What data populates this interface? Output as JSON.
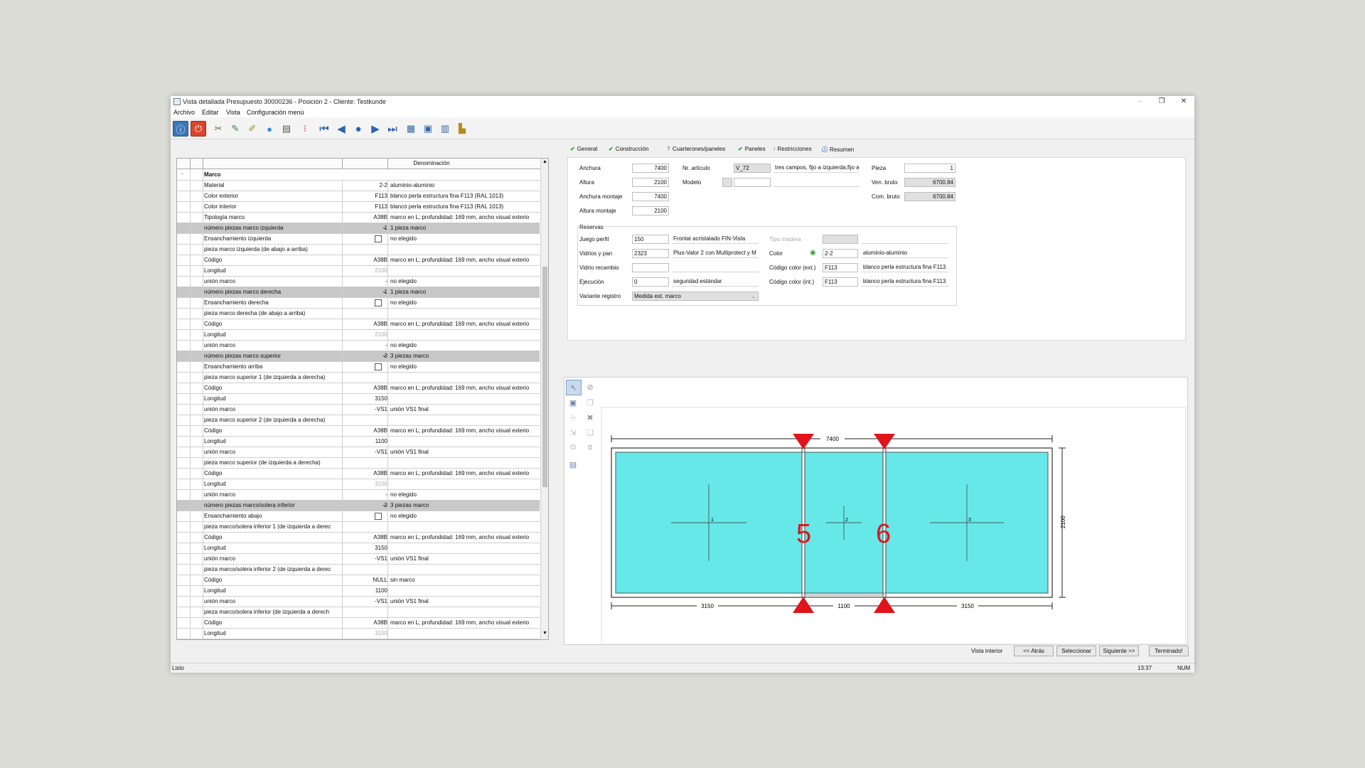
{
  "window": {
    "title": "Vista detallada Presupuesto 30000236 - Posición 2 - Cliente: Testkunde",
    "minimize_glyph": "–",
    "restore_glyph": "❐",
    "close_glyph": "✕"
  },
  "menu": [
    "Archivo",
    "Editar",
    "Vista",
    "Configuración menú"
  ],
  "toolbar": {
    "icons": [
      "info-icon",
      "power-icon",
      "tools-icon",
      "edit-icon",
      "pen-icon",
      "colors-icon",
      "document-icon",
      "traffic-light-icon",
      "first-icon",
      "prev-icon",
      "record-icon",
      "next-icon",
      "last-icon",
      "grid-view-icon",
      "select-view-icon",
      "table-view-icon",
      "tree-view-icon"
    ]
  },
  "grid": {
    "header": "Denominación",
    "collapse": "-",
    "section": "Marco",
    "rows": [
      {
        "k": "Material",
        "v": "2-2",
        "d": "aluminio-aluminio"
      },
      {
        "k": "Color exterior",
        "v": "F113",
        "d": "blanco perla estructura fina F113 (RAL 1013)"
      },
      {
        "k": "Color interior",
        "v": "F113",
        "d": "blanco perla estructura fina F113 (RAL 1013)"
      },
      {
        "k": "Tipología marco",
        "v": "A38B",
        "d": "marco en L; profundidad: 169 mm, ancho visual exterio"
      },
      {
        "k": "número piezas marco izquierda",
        "v": "1",
        "d": "1 pieza marco",
        "gray": true,
        "dd": true
      },
      {
        "k": "Ensanchamiento izquierda",
        "v": "",
        "d": "no elegido",
        "chk": true
      },
      {
        "k": "pieza marco izquierda (de abajo a arriba)",
        "v": "",
        "d": ""
      },
      {
        "k": "Código",
        "v": "A38B",
        "d": "marco en L; profundidad: 169 mm, ancho visual exterio"
      },
      {
        "k": "Longitud",
        "v": "2100",
        "d": "",
        "dim": true
      },
      {
        "k": "unión marco",
        "v": "-",
        "d": "no elegido"
      },
      {
        "k": "número piezas marco derecha",
        "v": "1",
        "d": "1 pieza marco",
        "gray": true,
        "dd": true
      },
      {
        "k": "Ensanchamiento derecha",
        "v": "",
        "d": "no elegido",
        "chk": true
      },
      {
        "k": "pieza marco derecha (de abajo a arriba)",
        "v": "",
        "d": ""
      },
      {
        "k": "Código",
        "v": "A38B",
        "d": "marco en L; profundidad: 169 mm, ancho visual exterio"
      },
      {
        "k": "Longitud",
        "v": "2100",
        "d": "",
        "dim": true
      },
      {
        "k": "unión marco",
        "v": "-",
        "d": "no elegido"
      },
      {
        "k": "número piezas marco superior",
        "v": "3",
        "d": "3 piezas marco",
        "gray": true,
        "dd": true
      },
      {
        "k": "Ensanchamiento arriba",
        "v": "",
        "d": "no elegido",
        "chk": true
      },
      {
        "k": "pieza marco superior 1 (de izquierda a derecha)",
        "v": "",
        "d": ""
      },
      {
        "k": "Código",
        "v": "A38B",
        "d": "marco en L; profundidad: 169 mm, ancho visual exterio"
      },
      {
        "k": "Longitud",
        "v": "3150",
        "d": ""
      },
      {
        "k": "unión marco",
        "v": "-VS1",
        "d": "unión VS1 final"
      },
      {
        "k": "pieza marco superior 2 (de izquierda a derecha)",
        "v": "",
        "d": ""
      },
      {
        "k": "Código",
        "v": "A38B",
        "d": "marco en L; profundidad: 169 mm, ancho visual exterio"
      },
      {
        "k": "Longitud",
        "v": "1100",
        "d": ""
      },
      {
        "k": "unión marco",
        "v": "-VS1",
        "d": "unión VS1 final"
      },
      {
        "k": "pieza marco superior (de izquierda a derecha)",
        "v": "",
        "d": ""
      },
      {
        "k": "Código",
        "v": "A38B",
        "d": "marco en L; profundidad: 169 mm, ancho visual exterio"
      },
      {
        "k": "Longitud",
        "v": "3150",
        "d": "",
        "dim": true
      },
      {
        "k": "unión marco",
        "v": "-",
        "d": "no elegido"
      },
      {
        "k": "número piezas marco/solera inferior",
        "v": "3",
        "d": "3 piezas marco",
        "gray": true,
        "dd": true
      },
      {
        "k": "Ensanchamiento abajo",
        "v": "",
        "d": "no elegido",
        "chk": true
      },
      {
        "k": "pieza marco/solera inferior 1 (de izquierda a derec",
        "v": "",
        "d": ""
      },
      {
        "k": "Código",
        "v": "A38B",
        "d": "marco en L; profundidad: 169 mm, ancho visual exterio"
      },
      {
        "k": "Longitud",
        "v": "3150",
        "d": ""
      },
      {
        "k": "unión marco",
        "v": "-VS1",
        "d": "unión VS1 final"
      },
      {
        "k": "pieza marco/solera inferior 2 (de izquierda a derec",
        "v": "",
        "d": ""
      },
      {
        "k": "Código",
        "v": "NULL",
        "d": "sin marco"
      },
      {
        "k": "Longitud",
        "v": "1100",
        "d": ""
      },
      {
        "k": "unión marco",
        "v": "-VS1",
        "d": "unión VS1 final"
      },
      {
        "k": "pieza marco/solera inferior (de izquierda a derech",
        "v": "",
        "d": ""
      },
      {
        "k": "Código",
        "v": "A38B",
        "d": "marco en L; profundidad: 169 mm, ancho visual exterio"
      },
      {
        "k": "Longitud",
        "v": "3150",
        "d": "",
        "dim": true
      }
    ]
  },
  "tabs": [
    {
      "label": "General",
      "icon": "check-icon"
    },
    {
      "label": "Construcción",
      "icon": "check-icon"
    },
    {
      "label": "Cuarterones/paneles",
      "icon": "question-icon"
    },
    {
      "label": "Paneles",
      "icon": "check-icon"
    },
    {
      "label": "Restricciones",
      "icon": "warning-icon"
    },
    {
      "label": "Resumen",
      "icon": "info-icon"
    }
  ],
  "general": {
    "anchura_label": "Anchura",
    "anchura": "7400",
    "altura_label": "Altura",
    "altura": "2100",
    "anchura_montaje_label": "Anchura montaje",
    "anchura_montaje": "7400",
    "altura_montaje_label": "Altura montaje",
    "altura_montaje": "2100",
    "nr_articulo_label": "Nr. artículo",
    "nr_articulo": "V_72",
    "nr_articulo_desc": "tres campos, fijo a izquierda,fijo a",
    "modelo_label": "Modelo",
    "pieza_label": "Pieza",
    "pieza": "1",
    "ven_bruto_label": "Ven. bruto",
    "ven_bruto": "6700.84",
    "com_bruto_label": "Com. bruto",
    "com_bruto": "6700.84",
    "reservas_label": "Reservas",
    "juego_perfil_label": "Juego perfil",
    "juego_perfil": "150",
    "juego_perfil_desc": "Frontal acristalado FIN-Vista",
    "vidrios_label": "Vidrios y pan",
    "vidrios": "2323",
    "vidrios_desc": "Plus-Valor 2 con Multiprotect y M",
    "vidrio_recambio_label": "Vidrio recambio",
    "ejecucion_label": "Ejecución",
    "ejecucion": "0",
    "ejecucion_desc": "seguridad estándar",
    "variante_label": "Variante registro",
    "variante": "Medida ext. marco",
    "tipo_madera_label": "Tipo madera",
    "color_label": "Color",
    "color": "2-2",
    "color_desc": "aluminio-aluminio",
    "codigo_ext_label": "Código color (ext.)",
    "codigo_ext": "F113",
    "codigo_ext_desc": "blanco perla estructura fina F113",
    "codigo_int_label": "Código color (int.)",
    "codigo_int": "F113",
    "codigo_int_desc": "blanco perla estructura fina F113"
  },
  "drawing": {
    "glass_color": "#66e8e8",
    "marker_color": "#e0141a",
    "total_width": "7400",
    "height": "2100",
    "segments": [
      "3150",
      "1100",
      "3150"
    ],
    "pane_numbers": [
      "1",
      "2",
      "3"
    ],
    "markers": [
      "5",
      "6"
    ]
  },
  "bottom": {
    "vista": "Vista interior",
    "atras": "<< Atrás",
    "seleccionar": "Seleccionar",
    "siguiente": "Siguiente >>",
    "terminado": "Terminado!"
  },
  "status": {
    "left": "Listo",
    "time": "13:37",
    "num": "NUM"
  }
}
